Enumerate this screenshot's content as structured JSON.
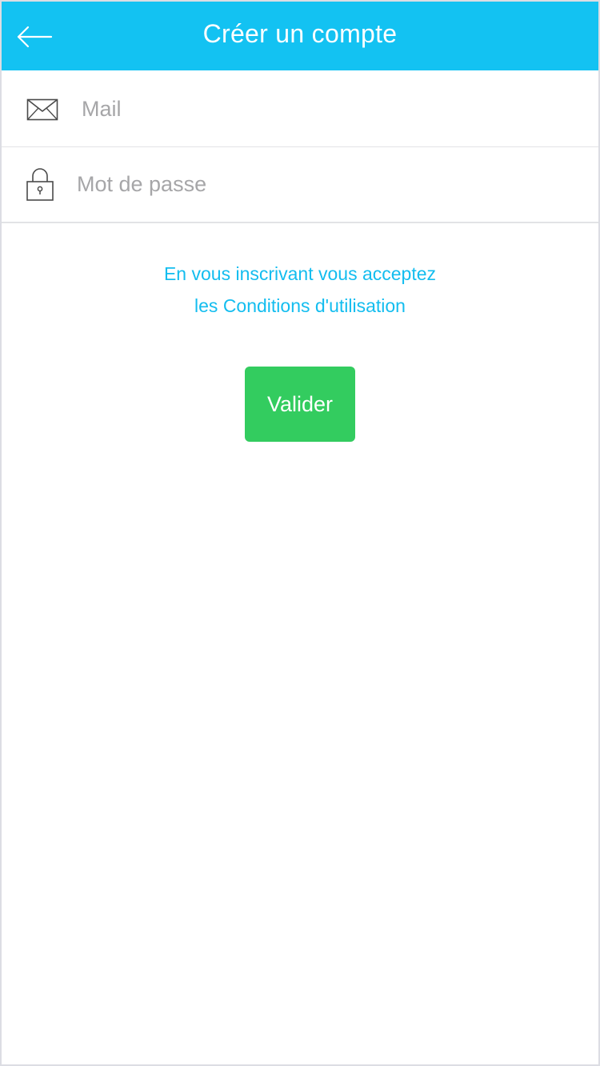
{
  "header": {
    "title": "Créer un compte",
    "back_icon": "arrow-left-icon",
    "background_color": "#13c2f2"
  },
  "form": {
    "mail": {
      "placeholder": "Mail",
      "value": "",
      "icon": "envelope-icon"
    },
    "password": {
      "placeholder": "Mot de passe",
      "value": "",
      "icon": "lock-icon"
    }
  },
  "terms": {
    "line1": "En vous inscrivant vous acceptez",
    "line2": "les Conditions d'utilisation",
    "color": "#13bdef"
  },
  "submit": {
    "label": "Valider",
    "color": "#33cc5f"
  }
}
